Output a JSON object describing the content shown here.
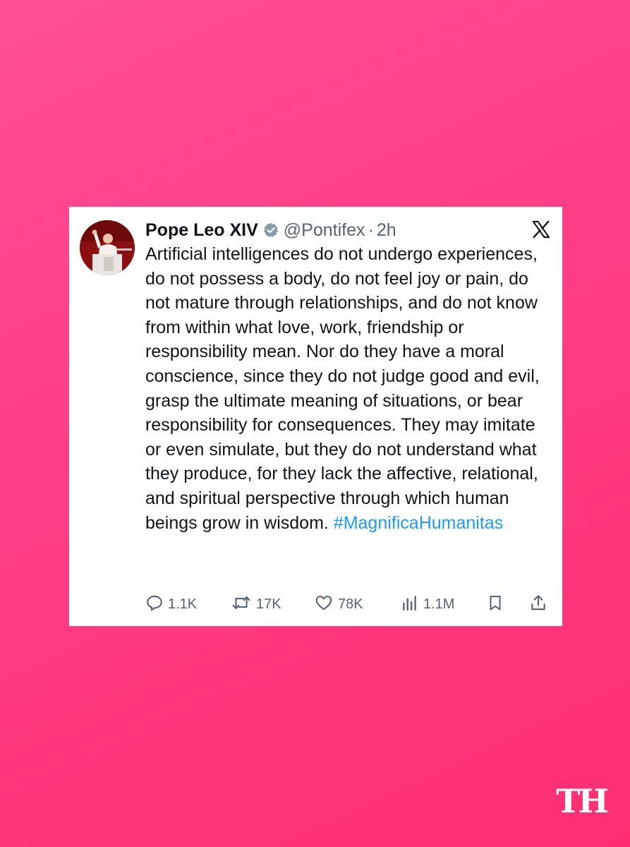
{
  "tweet": {
    "display_name": "Pope Leo XIV",
    "handle": "@Pontifex",
    "separator": "·",
    "time": "2h",
    "text": "Artificial intelligences do not undergo experiences, do not possess a body, do not feel joy or pain, do not mature through relationships, and do not know from within what love, work, friendship or responsibility mean. Nor do they have a moral conscience, since they do not judge good and evil, grasp the ultimate meaning of situations, or bear responsibility for consequences. They may imitate or even simulate, but they do not understand what they produce, for they lack the affective, relational, and spiritual perspective through which human beings grow in wisdom.",
    "hashtag": "#MagnificaHumanitas",
    "verified_icon": "verified-badge-icon",
    "platform_icon": "x-logo-icon"
  },
  "actions": {
    "replies": "1.1K",
    "reposts": "17K",
    "likes": "78K",
    "views": "1.1M",
    "bookmark_icon": "bookmark-icon",
    "share_icon": "share-icon"
  },
  "brand": {
    "watermark": "TH"
  },
  "colors": {
    "background_start": "#ff4f95",
    "background_end": "#ff2f72",
    "hashtag": "#1d9bf0",
    "secondary_text": "#536471",
    "primary_text": "#0f1419"
  }
}
